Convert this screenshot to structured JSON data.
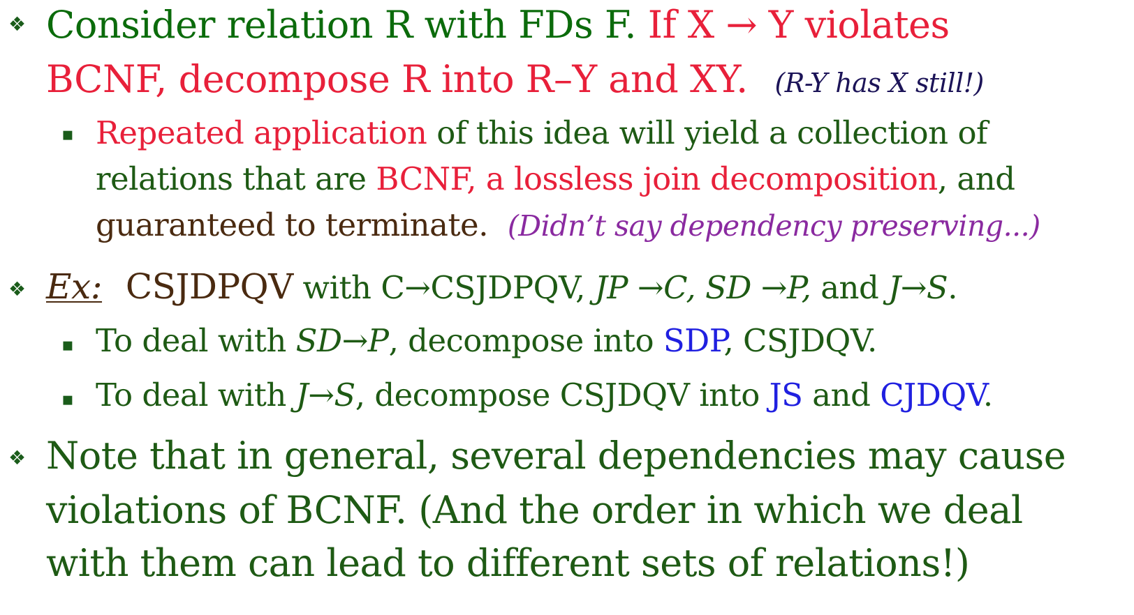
{
  "bullets": {
    "diamond": "❖",
    "square": "▪"
  },
  "p1": {
    "a": "Consider relation R with FDs F.  ",
    "b": "If X → Y violates",
    "c": "BCNF, decompose R into R–Y and XY.",
    "d": "(R-Y has X still!)"
  },
  "p1s1": {
    "a": "Repeated application",
    "b": " of this idea will yield a collection of",
    "c": "relations that are ",
    "d": "BCNF, a lossless join decomposition",
    "e": ", and",
    "f": "guaranteed to terminate.",
    "g": "(Didn’t say dependency preserving...)"
  },
  "p2": {
    "ex": "Ex:",
    "rel": "CSJDPQV",
    "with": " with C→CSJDPQV, ",
    "fd1": "JP →C, SD →P,",
    "and": " and ",
    "fd2": "J→S",
    "end": "."
  },
  "p2s1": {
    "a": "To deal with ",
    "b": "SD→P",
    "c": ", decompose into  ",
    "d": "SDP",
    "e": ", CSJDQV."
  },
  "p2s2": {
    "a": "To deal with ",
    "b": "J→S",
    "c": ", decompose CSJDQV into ",
    "d": "JS",
    "e": " and ",
    "f": "CJDQV",
    "g": "."
  },
  "p3": {
    "a": "Note that in general, several dependencies may cause",
    "b": "violations of BCNF.  (And the order in which we deal",
    "c": "with them can lead to different sets of relations!)"
  }
}
